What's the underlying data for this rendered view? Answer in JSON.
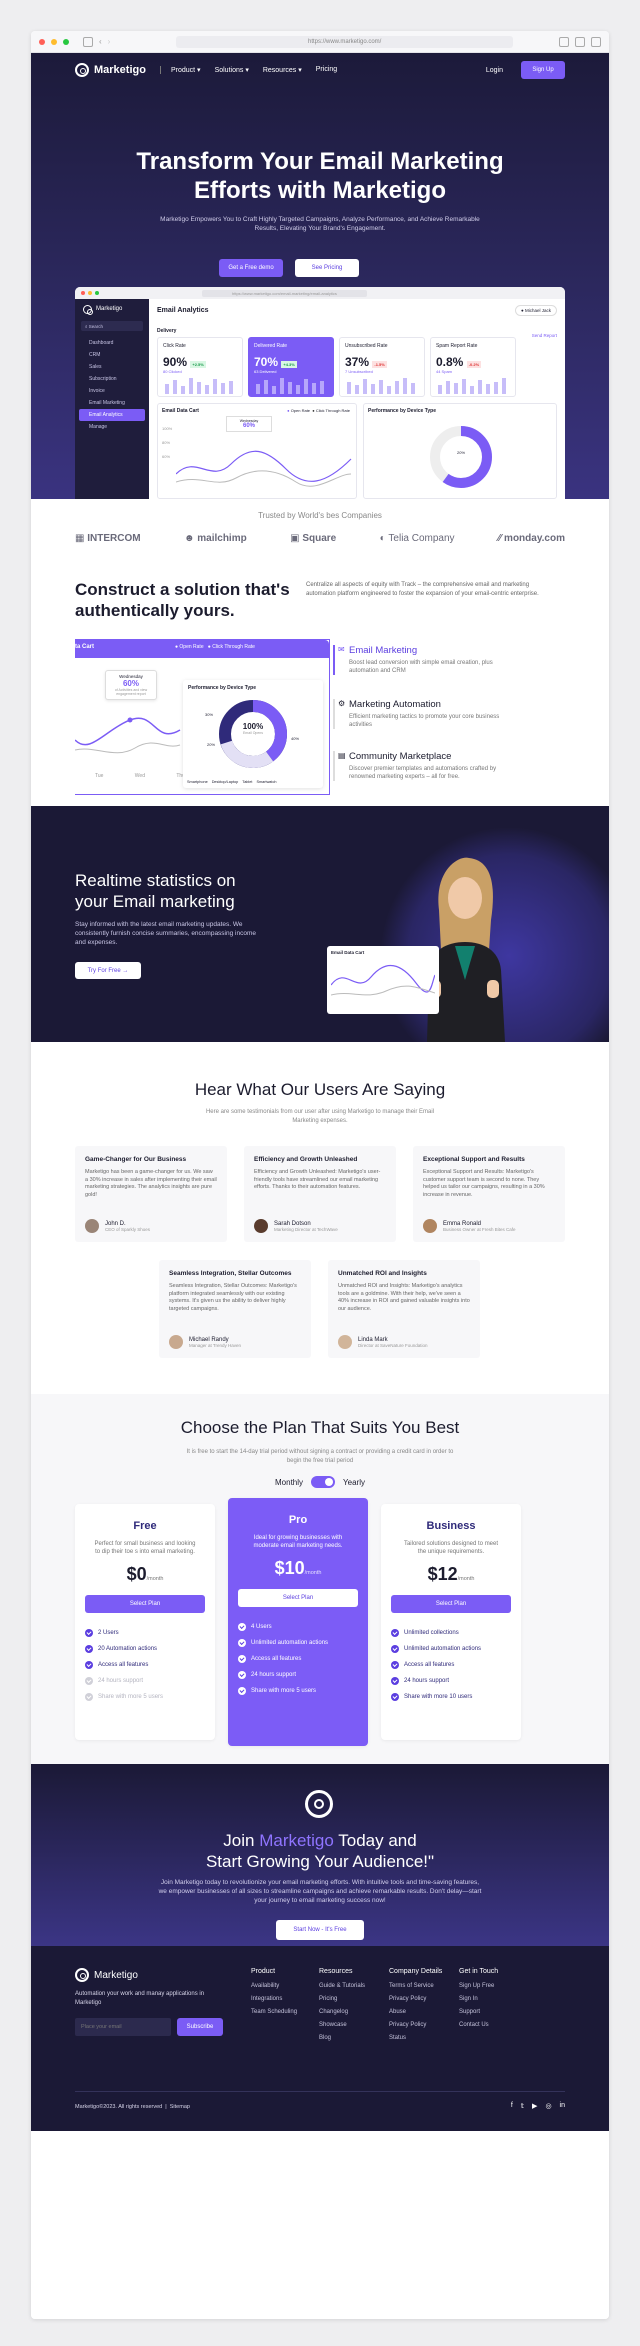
{
  "browser": {
    "url": "https://www.marketigo.com/"
  },
  "nav": {
    "brand": "Marketigo",
    "links": [
      "Product",
      "Solutions",
      "Resources",
      "Pricing"
    ],
    "login": "Login",
    "signup": "Sign Up"
  },
  "hero": {
    "title_line1": "Transform Your Email Marketing",
    "title_line2": "Efforts with Marketigo",
    "subtitle": "Marketigo Empowers You to Craft Highly Targeted Campaigns, Analyze Performance, and Achieve Remarkable Results, Elevating Your Brand's Engagement.",
    "cta_primary": "Get a Free demo",
    "cta_secondary": "See Pricing"
  },
  "dashboard": {
    "url": "https://www.marketigo.com/email-marketing/email-analytics",
    "brand": "Marketigo",
    "title": "Email Analytics",
    "user": "Michael Jack",
    "section": "Delivery",
    "send_report": "Send Report",
    "search": "Search",
    "sidebar": [
      "Dashboard",
      "CRM",
      "Sales",
      "Subscription",
      "Invoice",
      "Email Marketing",
      "Email Analytics",
      "Manage"
    ],
    "kpis": [
      {
        "label": "Click Rate",
        "value": "90%",
        "delta": "+2.5%",
        "sub": "80 Clicked"
      },
      {
        "label": "Delivered Rate",
        "value": "70%",
        "delta": "+4.3%",
        "sub": "63 Delivered"
      },
      {
        "label": "Unsubscribed Rate",
        "value": "37%",
        "delta": "-1.5%",
        "sub": "7 Unsubscribed"
      },
      {
        "label": "Spam Report Rate",
        "value": "0.8%",
        "delta": "-0.2%",
        "sub": "44 Spam"
      }
    ],
    "cart_title": "Email Data Cart",
    "legend": [
      "Open Rate",
      "Click Through Rate"
    ],
    "tooltip_day": "Wednesday",
    "tooltip_value": "60%",
    "y_ticks": [
      "100%",
      "80%",
      "60%"
    ],
    "device_title": "Performance by Device Type",
    "donut_label": "20%"
  },
  "trusted": {
    "title": "Trusted by World's bes Companies",
    "logos": [
      "INTERCOM",
      "mailchimp",
      "Square",
      "Telia Company",
      "monday.com"
    ]
  },
  "solution": {
    "title_line1": "Construct a solution that's",
    "title_line2": "authentically yours.",
    "desc": "Centralize all aspects of equity with Track – the comprehensive email and marketing automation platform engineered to foster the expansion of your email-centric enterprise.",
    "chart_label": "ta Cart",
    "legend": [
      "Open Rate",
      "Click Through Rate"
    ],
    "tooltip_day": "Wednesday",
    "tooltip_value": "60%",
    "tooltip_sub": "of Activities and view engagement report",
    "days": [
      "Tue",
      "Wed",
      "Thu"
    ],
    "device_title": "Performance by Device Type",
    "donut_center": "100%",
    "donut_sub": "Email Opens",
    "donut_pcts": [
      "30%",
      "20%",
      "40%"
    ],
    "device_legend": [
      "Smartphone",
      "Desktop/Laptop",
      "Tablet",
      "Smartwatch"
    ],
    "features": [
      {
        "title": "Email Marketing",
        "desc": "Boost lead conversion with simple email creation, plus automation and CRM"
      },
      {
        "title": "Marketing Automation",
        "desc": "Efficient marketing tactics to promote your core business activities"
      },
      {
        "title": "Community Marketplace",
        "desc": "Discover premier templates and automations crafted by renowned marketing experts – all for free."
      }
    ]
  },
  "stats": {
    "title_line1": "Realtime statistics on",
    "title_line2": "your Email marketing",
    "desc": "Stay informed with the latest email marketing updates. We consistently furnish concise summaries, encompassing income and expenses.",
    "cta": "Try For Free",
    "chart_title": "Email Data Cart"
  },
  "testimonials": {
    "title": "Hear What Our Users Are Saying",
    "subtitle": "Here are some testimonials from our user after using Marketigo to manage their Email Marketing expenses.",
    "items": [
      {
        "title": "Game-Changer for Our Business",
        "text": "Marketigo has been a game-changer for us. We saw a 30% increase in sales after implementing their email marketing strategies. The analytics insights are pure gold!",
        "name": "John D.",
        "role": "CEO of Sparkly Shoes"
      },
      {
        "title": "Efficiency and Growth Unleashed",
        "text": "Efficiency and Growth Unleashed: Marketigo's user-friendly tools have streamlined our email marketing efforts. Thanks to their automation features.",
        "name": "Sarah Dotson",
        "role": "Marketing Director at TechWave"
      },
      {
        "title": "Exceptional Support and Results",
        "text": "Exceptional Support and Results: Marketigo's customer support team is second to none. They helped us tailor our campaigns, resulting in a 30% increase in revenue.",
        "name": "Emma Ronald",
        "role": "Business Owner at Fresh Bites Cafe"
      },
      {
        "title": "Seamless Integration, Stellar Outcomes",
        "text": "Seamless Integration, Stellar Outcomes: Marketigo's platform integrated seamlessly with our existing systems. It's given us the ability to deliver highly targeted campaigns.",
        "name": "Michael Randy",
        "role": "Manager at Trendy Haven"
      },
      {
        "title": "Unmatched ROI and Insights",
        "text": "Unmatched ROI and Insights: Marketigo's analytics tools are a goldmine. With their help, we've seen a 40% increase in ROI and gained valuable insights into our audience.",
        "name": "Linda Mark",
        "role": "Director at SaveNature Foundation"
      }
    ]
  },
  "pricing": {
    "title": "Choose the Plan That Suits You Best",
    "subtitle": "It is free to start the 14-day trial period without signing a contract or providing a credit card in order to begin the free trial period",
    "monthly": "Monthly",
    "yearly": "Yearly",
    "select": "Select Plan",
    "plans": [
      {
        "name": "Free",
        "desc": "Perfect for small business and looking to dip their toe s into email marketing.",
        "price": "$0",
        "per": "/month",
        "features": [
          "2 Users",
          "20 Automation actions",
          "Access all features",
          "24 hours support",
          "Share with more 5 users"
        ],
        "off": [
          false,
          false,
          false,
          true,
          true
        ]
      },
      {
        "name": "Pro",
        "desc": "Ideal for growing businesses with moderate email marketing needs.",
        "price": "$10",
        "per": "/month",
        "features": [
          "4 Users",
          "Unlimited automation actions",
          "Access all features",
          "24 hours support",
          "Share with more 5 users"
        ],
        "off": [
          false,
          false,
          false,
          false,
          false
        ]
      },
      {
        "name": "Business",
        "desc": "Tailored solutions designed to meet the unique requirements.",
        "price": "$12",
        "per": "/month",
        "features": [
          "Unlimited collections",
          "Unlimited automation actions",
          "Access all features",
          "24 hours support",
          "Share with more 10 users"
        ],
        "off": [
          false,
          false,
          false,
          false,
          false
        ]
      }
    ]
  },
  "cta": {
    "title_pre": "Join ",
    "title_brand": "Marketigo",
    "title_post": " Today and",
    "title_line2": "Start Growing Your Audience!\"",
    "desc": "Join Marketigo today to revolutionize your email marketing efforts. With intuitive tools and time-saving features, we empower businesses of all sizes to streamline campaigns and achieve remarkable results. Don't delay—start your journey to email marketing success now!",
    "button": "Start Now - It's Free"
  },
  "footer": {
    "brand": "Marketigo",
    "tagline": "Automation your work and manay applications in Marketigo",
    "email_placeholder": "Place your email",
    "subscribe": "Subscribe",
    "columns": [
      {
        "title": "Product",
        "links": [
          "Availability",
          "Integrations",
          "Team Scheduling"
        ]
      },
      {
        "title": "Resources",
        "links": [
          "Guide & Tutorials",
          "Pricing",
          "Changelog",
          "Showcase",
          "Blog"
        ]
      },
      {
        "title": "Company Details",
        "links": [
          "Terms of Service",
          "Privacy Policy",
          "Abuse",
          "Privacy Policy",
          "Status"
        ]
      },
      {
        "title": "Get in Touch",
        "links": [
          "Sign Up Free",
          "Sign In",
          "Support",
          "Contact Us"
        ]
      }
    ],
    "copyright": "Marketigo©2023. All rights reserved",
    "sitemap": "Sitemap",
    "social": [
      "facebook-icon",
      "twitter-icon",
      "youtube-icon",
      "instagram-icon",
      "linkedin-icon"
    ]
  },
  "colors": {
    "accent": "#7b5cf5",
    "dark": "#1b1936",
    "hero_end": "#3a3380"
  }
}
